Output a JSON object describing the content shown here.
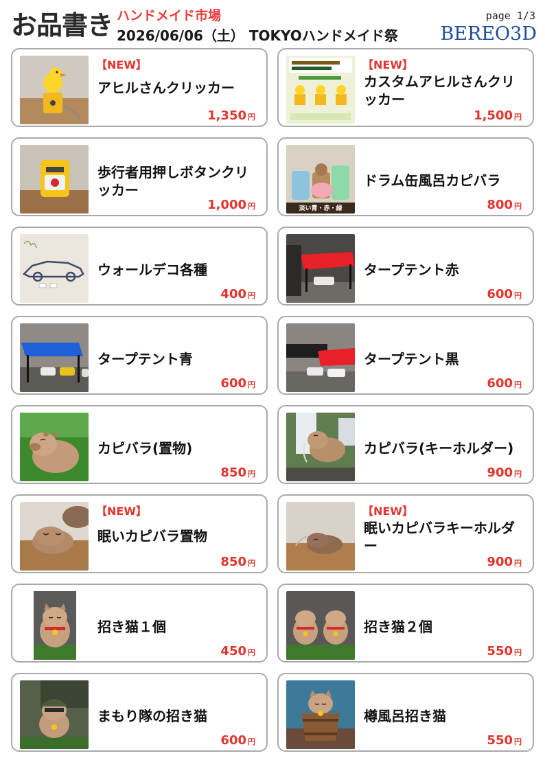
{
  "header": {
    "title": "お品書き",
    "market": "ハンドメイド市場",
    "date_event": "2026/06/06（土） TOKYOハンドメイド祭",
    "page": "page 1/3",
    "brand": "BEREO3D"
  },
  "currency_unit": "円",
  "products": [
    {
      "name": "アヒルさんクリッカー",
      "badge": "【NEW】",
      "price": "1,350",
      "image_icon": "duck-clicker-icon"
    },
    {
      "name": "カスタムアヒルさんクリッカー",
      "badge": "【NEW】",
      "price": "1,500",
      "image_icon": "custom-duck-poster-icon"
    },
    {
      "name": "歩行者用押しボタンクリッカー",
      "badge": "",
      "price": "1,000",
      "image_icon": "push-button-icon"
    },
    {
      "name": "ドラム缶風呂カピバラ",
      "badge": "",
      "price": "800",
      "image_icon": "drum-bath-capybara-icon",
      "image_caption": "淡い青・赤・緑"
    },
    {
      "name": "ウォールデコ各種",
      "badge": "",
      "price": "400",
      "image_icon": "wall-deco-car-icon"
    },
    {
      "name": "タープテント赤",
      "badge": "",
      "price": "600",
      "image_icon": "tarp-tent-red-icon"
    },
    {
      "name": "タープテント青",
      "badge": "",
      "price": "600",
      "image_icon": "tarp-tent-blue-icon"
    },
    {
      "name": "タープテント黒",
      "badge": "",
      "price": "600",
      "image_icon": "tarp-tent-black-icon"
    },
    {
      "name": "カピバラ(置物)",
      "badge": "",
      "price": "850",
      "image_icon": "capybara-figure-icon"
    },
    {
      "name": "カピバラ(キーホルダー)",
      "badge": "",
      "price": "900",
      "image_icon": "capybara-keychain-icon"
    },
    {
      "name": "眠いカピバラ置物",
      "badge": "【NEW】",
      "price": "850",
      "image_icon": "sleepy-capybara-icon"
    },
    {
      "name": "眠いカピバラキーホルダー",
      "badge": "【NEW】",
      "price": "900",
      "image_icon": "sleepy-capybara-keychain-icon"
    },
    {
      "name": "招き猫１個",
      "badge": "",
      "price": "450",
      "image_icon": "lucky-cat-icon"
    },
    {
      "name": "招き猫２個",
      "badge": "",
      "price": "550",
      "image_icon": "lucky-cats-pair-icon"
    },
    {
      "name": "まもり隊の招き猫",
      "badge": "",
      "price": "600",
      "image_icon": "soldier-lucky-cat-icon"
    },
    {
      "name": "樽風呂招き猫",
      "badge": "",
      "price": "550",
      "image_icon": "barrel-bath-cat-icon"
    }
  ]
}
